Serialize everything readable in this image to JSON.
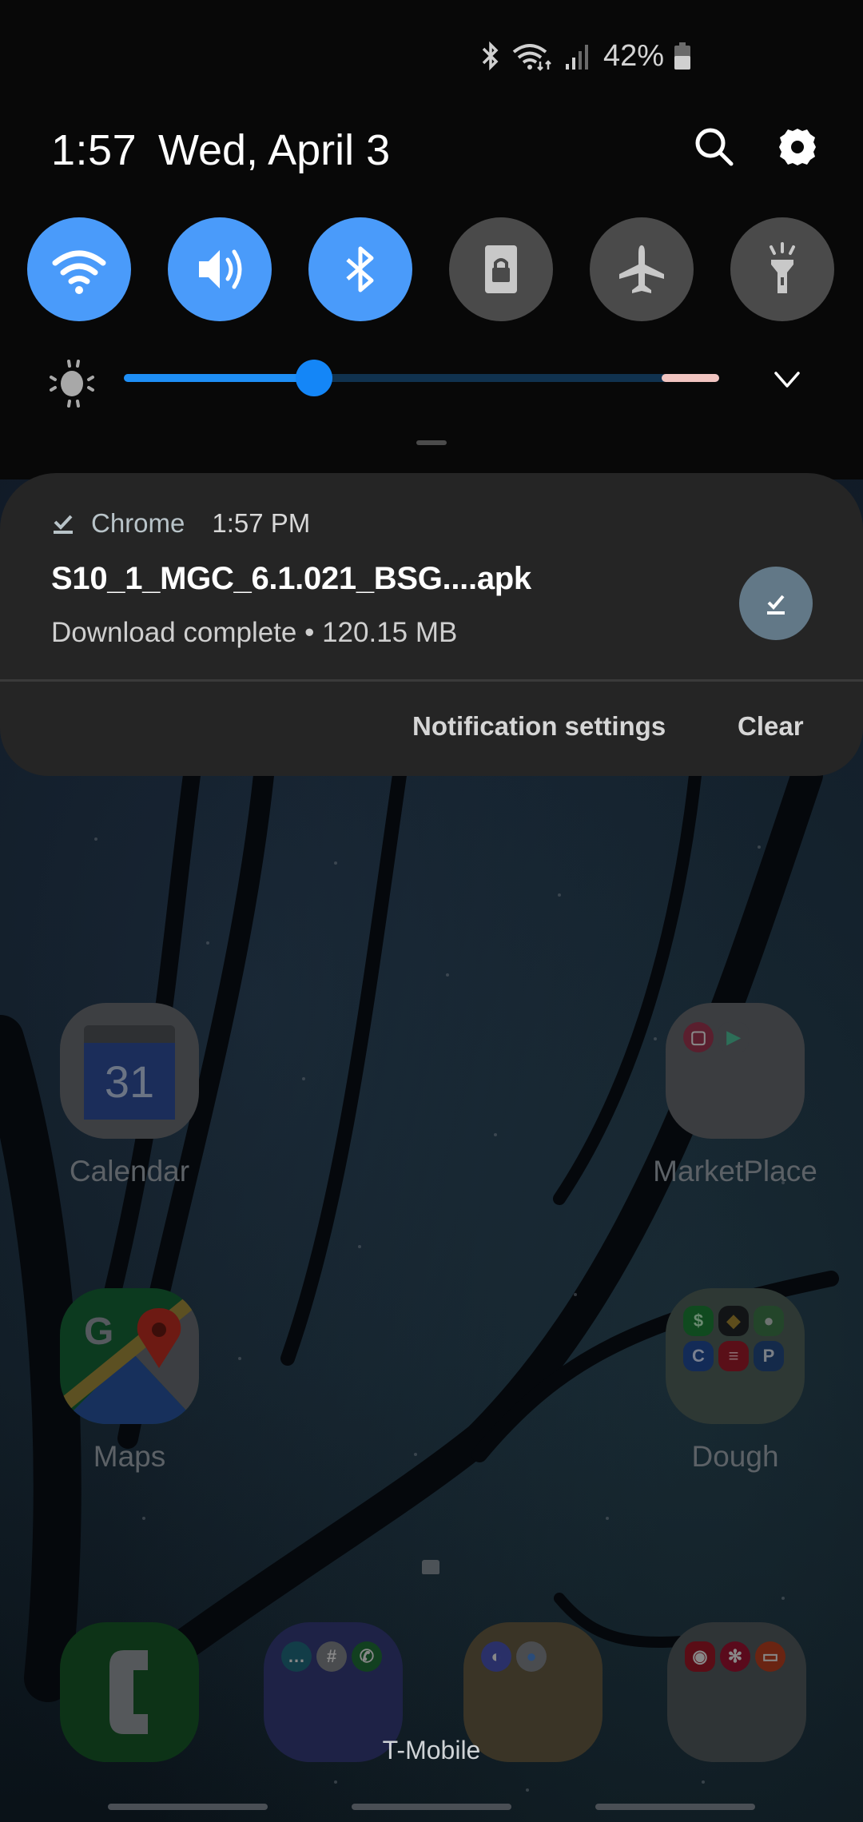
{
  "status_bar": {
    "icons": [
      "bluetooth-icon",
      "wifi-icon",
      "signal-icon",
      "battery-icon"
    ],
    "battery_percent": "42%"
  },
  "header": {
    "time": "1:57",
    "date": "Wed, April 3",
    "search_icon": "search-icon",
    "settings_icon": "gear-icon"
  },
  "quick_toggles": [
    {
      "name": "Wi-Fi",
      "icon": "wifi-icon",
      "state": "on"
    },
    {
      "name": "Sound",
      "icon": "volume-icon",
      "state": "on"
    },
    {
      "name": "Bluetooth",
      "icon": "bluetooth-icon",
      "state": "on"
    },
    {
      "name": "Screen lock",
      "icon": "rotation-lock-icon",
      "state": "off"
    },
    {
      "name": "Airplane mode",
      "icon": "airplane-icon",
      "state": "off"
    },
    {
      "name": "Flashlight",
      "icon": "flashlight-icon",
      "state": "off"
    }
  ],
  "brightness": {
    "value_fraction": 0.32,
    "high_zone_fraction": 0.1
  },
  "colors": {
    "toggle_on": "#4a9bfa",
    "toggle_off": "#4a4a4a",
    "slider_fill": "#1e8ef5",
    "slider_high_zone": "#f1c4c0",
    "card_bg": "#252525",
    "notification_action": "#627887"
  },
  "notification": {
    "app_name": "Chrome",
    "time": "1:57 PM",
    "title": "S10_1_MGC_6.1.021_BSG....apk",
    "subtitle": "Download complete • 120.15 MB",
    "actions": {
      "settings_label": "Notification settings",
      "clear_label": "Clear"
    }
  },
  "home_screen": {
    "apps": [
      {
        "label": "Calendar",
        "icon": "calendar-icon",
        "day": "31"
      },
      {
        "label": "MarketPlace",
        "icon": "folder-icon"
      },
      {
        "label": "Maps",
        "icon": "maps-icon",
        "glyph": "G"
      },
      {
        "label": "Dough",
        "icon": "folder-icon",
        "minis": [
          "$",
          "◆",
          "●",
          "C",
          "≡",
          "P"
        ]
      }
    ],
    "dock": [
      {
        "name": "Phone",
        "icon": "phone-icon"
      },
      {
        "name": "Messaging folder",
        "icon": "folder-icon"
      },
      {
        "name": "Browser folder",
        "icon": "folder-icon"
      },
      {
        "name": "Camera folder",
        "icon": "folder-icon"
      }
    ],
    "carrier": "T-Mobile"
  }
}
